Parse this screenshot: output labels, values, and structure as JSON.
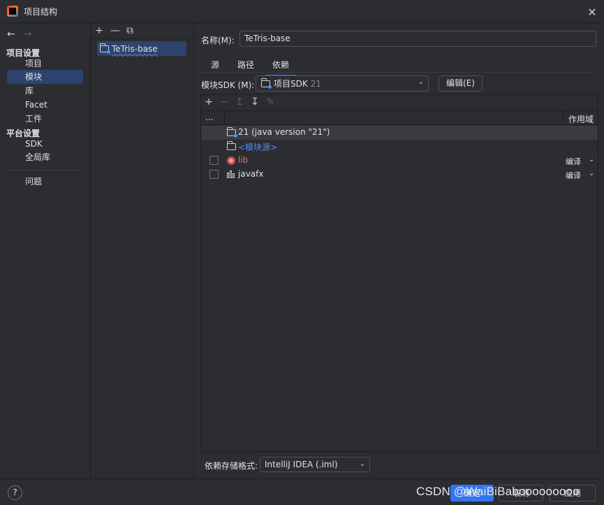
{
  "window": {
    "title": "项目结构",
    "close_glyph": "✕"
  },
  "left_nav": {
    "back_glyph": "←",
    "forward_glyph": "→",
    "project_settings_heading": "项目设置",
    "project_items": [
      {
        "label": "项目"
      },
      {
        "label": "模块",
        "selected": true
      },
      {
        "label": "库"
      },
      {
        "label": "Facet"
      },
      {
        "label": "工件"
      }
    ],
    "platform_settings_heading": "平台设置",
    "platform_items": [
      {
        "label": "SDK"
      },
      {
        "label": "全局库"
      }
    ],
    "problems_label": "问题"
  },
  "module_list": {
    "toolbar": {
      "add": "+",
      "remove": "—",
      "copy": "⧉"
    },
    "items": [
      {
        "label": "TeTris-base",
        "icon": "module-folder-icon"
      }
    ]
  },
  "module_detail": {
    "name_label": "名称(M):",
    "name_value": "TeTris-base",
    "tabs": [
      {
        "label": "源"
      },
      {
        "label": "路径"
      },
      {
        "label": "依赖",
        "active": true
      }
    ],
    "sdk_label": "模块SDK (M):",
    "sdk_value": "项目SDK",
    "sdk_version": "21",
    "edit_button": "编辑(E)",
    "deps_toolbar": {
      "add": "+",
      "remove": "−",
      "up": "↥",
      "down": "↧",
      "edit": "✎"
    },
    "deps_header": {
      "dots": "...",
      "scope": "作用域"
    },
    "dependencies": [
      {
        "name": "21 (java version \"21\")",
        "icon": "sdk-folder-icon",
        "color": "#dfe1e5",
        "checkbox": false,
        "scope": "",
        "selected": true
      },
      {
        "name": "<模块源>",
        "icon": "source-folder-icon",
        "color": "#548af7",
        "checkbox": false,
        "scope": ""
      },
      {
        "name": "lib",
        "icon": "library-icon",
        "color": "#e06c6c",
        "checkbox": true,
        "scope": "编译"
      },
      {
        "name": "javafx",
        "icon": "jar-library-icon",
        "color": "#dfe1e5",
        "checkbox": true,
        "scope": "编译"
      }
    ],
    "storage_label": "依赖存储格式:",
    "storage_value": "IntelliJ IDEA (.iml)"
  },
  "bottom_bar": {
    "help": "?",
    "ok_button": "确定",
    "cancel_button": "取消",
    "apply_button": "应用"
  },
  "watermark": "CSDN @WaiBiBabooooooooo",
  "colors": {
    "background": "#2b2d30",
    "selection": "#2e436e",
    "accent": "#3574f0",
    "row_selected": "#393b40",
    "lib_red": "#e06c6c",
    "source_blue": "#548af7"
  }
}
